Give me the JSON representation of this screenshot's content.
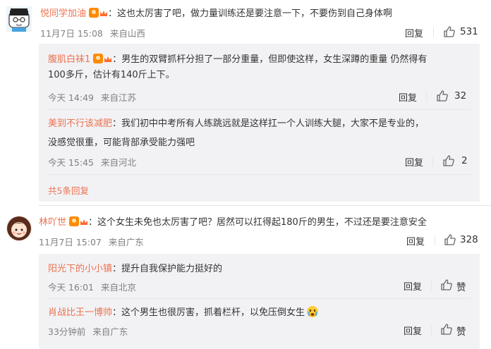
{
  "comments": [
    {
      "user": "悦同学加油",
      "text": "：这也太厉害了吧，做力量训练还是要注意一下，不要伤到自己身体啊",
      "time": "11月7日 15:08",
      "location": "来自山西",
      "reply_label": "回复",
      "likes": "531",
      "replies": [
        {
          "user": "腹肌白袜1",
          "text_line1": "：男生的双臂抓杆分担了一部分重量，但即使这样，女生深蹲的重量 仍然得有",
          "text_line2": "100多斤，估计有140斤上下。",
          "time": "今天 14:49",
          "location": "来自江苏",
          "reply_label": "回复",
          "likes": "32"
        },
        {
          "user": "美到不行该减肥",
          "text_line1": "：我们初中中考所有人练跳远就是这样扛一个人训练大腿，大家不是专业的，",
          "text_line2": "没感觉很重，可能背部承受能力强吧",
          "time": "今天 15:45",
          "location": "来自河北",
          "reply_label": "回复",
          "likes": "2"
        }
      ],
      "more_replies": "共5条回复"
    },
    {
      "user": "林吖世",
      "text": "：这个女生未免也太厉害了吧？居然可以扛得起180斤的男生，不过还是要注意安全",
      "time": "11月7日 15:07",
      "location": "来自广东",
      "reply_label": "回复",
      "likes": "328",
      "replies": [
        {
          "user": "阳光下的小小镇",
          "text_line1": "：提升自我保护能力挺好的",
          "time": "今天 16:01",
          "location": "来自北京",
          "reply_label": "回复",
          "likes": "赞"
        },
        {
          "user": "肖战比王一博帅",
          "text_line1": "：这个男生也很厉害，抓着栏杆，以免压倒女生",
          "time": "33分钟前",
          "location": "来自广东",
          "reply_label": "回复",
          "likes": "赞"
        }
      ]
    }
  ],
  "icons": {
    "like": "thumbs-up-icon",
    "badge": "fan-badge-icon",
    "emoji": "crying-face-emoji"
  },
  "colors": {
    "username": "#eb7350",
    "meta": "#808080",
    "sub_background": "#f2f2f5"
  }
}
